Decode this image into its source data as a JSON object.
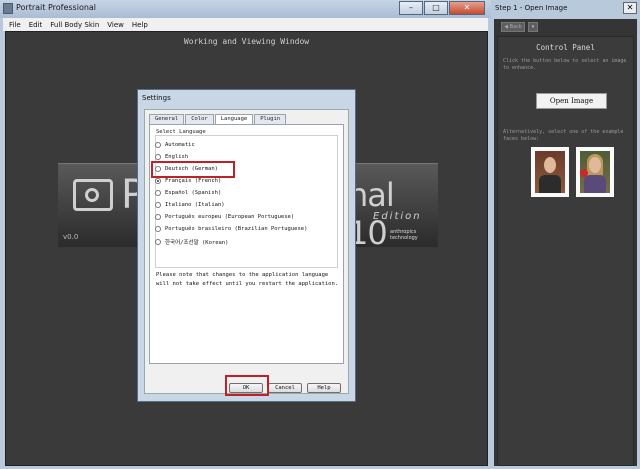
{
  "main_window": {
    "title": "Portrait Professional",
    "controls": {
      "minimize": "–",
      "maximize": "□",
      "close": "✕"
    },
    "menu": [
      "File",
      "Edit",
      "Full Body Skin",
      "View",
      "Help"
    ],
    "work_area_title": "Working and Viewing Window"
  },
  "splash": {
    "big_left": "P",
    "big_right": "nal 10",
    "edition": "Edition",
    "version": "v0.0",
    "brand_line1": "anthropics",
    "brand_line2": "technology"
  },
  "settings_dialog": {
    "title": "Settings",
    "tabs": [
      "General",
      "Color",
      "Language",
      "Plugin"
    ],
    "active_tab": "Language",
    "group_label": "Select Language",
    "options": [
      {
        "label": "Automatic",
        "selected": false
      },
      {
        "label": "English",
        "selected": false
      },
      {
        "label": "Deutsch (German)",
        "selected": false
      },
      {
        "label": "Français (French)",
        "selected": true
      },
      {
        "label": "Español (Spanish)",
        "selected": false
      },
      {
        "label": "Italiano (Italian)",
        "selected": false
      },
      {
        "label": "Português europeu (European Portuguese)",
        "selected": false
      },
      {
        "label": "Português brasileiro (Brazilian Portuguese)",
        "selected": false
      },
      {
        "label": "한국어/조선말 (Korean)",
        "selected": false
      }
    ],
    "note": "Please note that changes to the application language will not take effect until you restart the application.",
    "buttons": {
      "ok": "OK",
      "cancel": "Cancel",
      "help": "Help"
    },
    "highlight_color": "#c0202a"
  },
  "side_window": {
    "title": "Step 1 - Open Image",
    "close": "✕",
    "back_label": "◀ Back",
    "dropdown": "▾",
    "panel_title": "Control Panel",
    "instruction": "Click the button below to select an image to enhance.",
    "open_button": "Open Image",
    "alt_text": "Alternatively, select one of the example faces below:"
  }
}
